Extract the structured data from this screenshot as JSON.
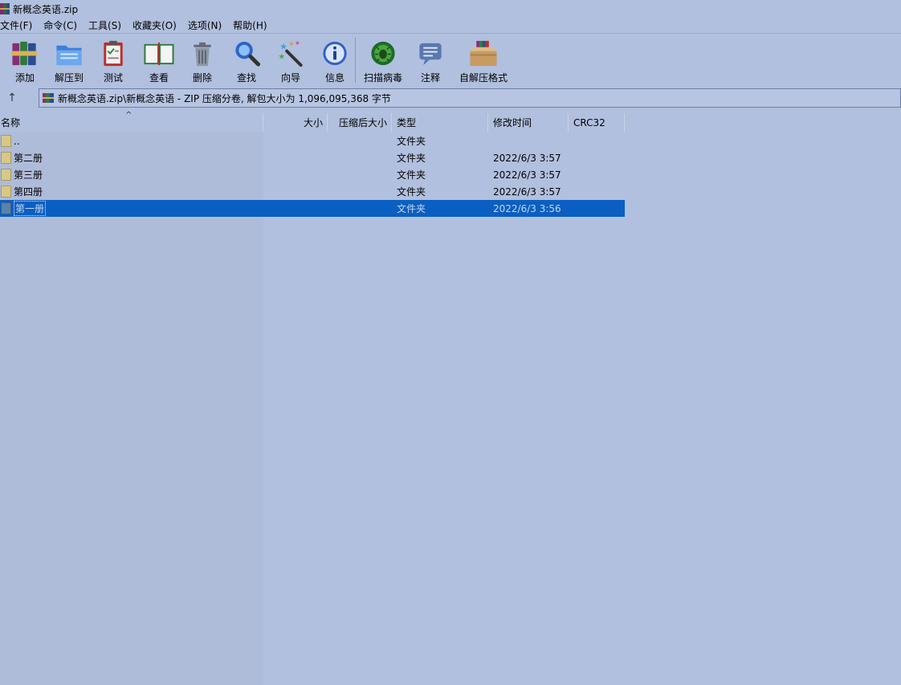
{
  "window": {
    "title": "新概念英语.zip"
  },
  "menu": [
    "文件(F)",
    "命令(C)",
    "工具(S)",
    "收藏夹(O)",
    "选项(N)",
    "帮助(H)"
  ],
  "toolbar": {
    "add": "添加",
    "extract": "解压到",
    "test": "测试",
    "view": "查看",
    "delete": "删除",
    "find": "查找",
    "wizard": "向导",
    "info": "信息",
    "scan": "扫描病毒",
    "comment": "注释",
    "sfx": "自解压格式"
  },
  "address": {
    "path": "新概念英语.zip\\新概念英语 - ZIP 压缩分卷, 解包大小为 1,096,095,368 字节"
  },
  "columns": {
    "name": "名称",
    "size": "大小",
    "packed": "压缩后大小",
    "type": "类型",
    "mtime": "修改时间",
    "crc": "CRC32"
  },
  "rows": [
    {
      "name": "..",
      "type": "文件夹",
      "mtime": ""
    },
    {
      "name": "第二册",
      "type": "文件夹",
      "mtime": "2022/6/3 3:57"
    },
    {
      "name": "第三册",
      "type": "文件夹",
      "mtime": "2022/6/3 3:57"
    },
    {
      "name": "第四册",
      "type": "文件夹",
      "mtime": "2022/6/3 3:57"
    },
    {
      "name": "第一册",
      "type": "文件夹",
      "mtime": "2022/6/3 3:56",
      "selected": true
    }
  ],
  "colors": {
    "background": "#b1c0de",
    "selection": "#0a5fc2"
  }
}
